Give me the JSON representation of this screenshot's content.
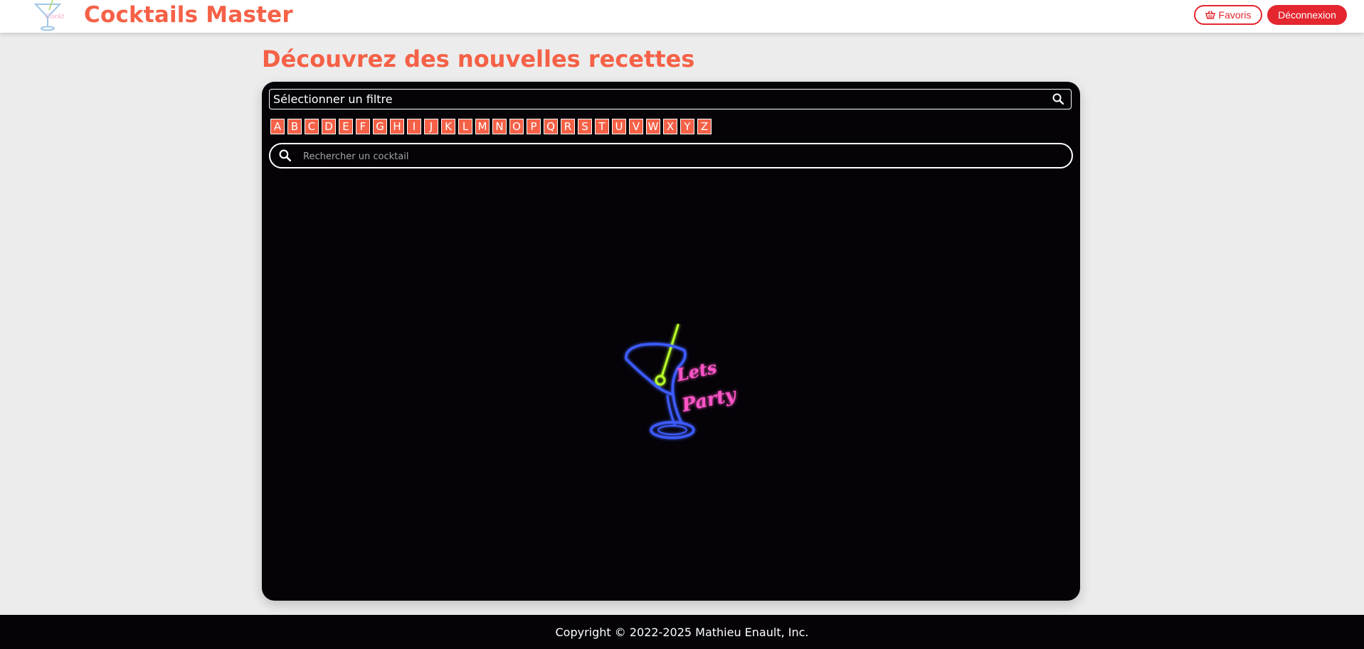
{
  "header": {
    "app_title": "Cocktails Master",
    "logo_icon": "cocktail-glass-logo",
    "favorites_label": "Favoris",
    "favorites_icon": "basket-icon",
    "logout_label": "Déconnexion"
  },
  "main": {
    "page_title": "Découvrez des nouvelles recettes",
    "filter": {
      "label": "Sélectionner un filtre",
      "icon": "search-icon"
    },
    "letters": [
      "A",
      "B",
      "C",
      "D",
      "E",
      "F",
      "G",
      "H",
      "I",
      "J",
      "K",
      "L",
      "M",
      "N",
      "O",
      "P",
      "Q",
      "R",
      "S",
      "T",
      "U",
      "V",
      "W",
      "X",
      "Y",
      "Z"
    ],
    "search": {
      "placeholder": "Rechercher un cocktail",
      "value": "",
      "icon": "search-icon"
    },
    "hero_image": "neon-cocktail-lets-party",
    "hero_text": [
      "Lets",
      "Party"
    ]
  },
  "footer": {
    "copyright": "Copyright © 2022-2025 Mathieu Enault, Inc."
  },
  "colors": {
    "brand": "#f56147",
    "danger": "#e4262f",
    "panel": "#050308",
    "background": "#ececec"
  }
}
